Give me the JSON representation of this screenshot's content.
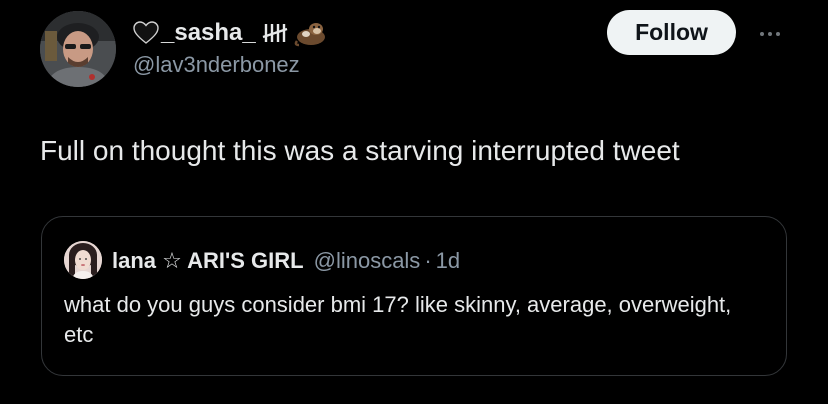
{
  "tweet": {
    "author": {
      "display_name": "_sasha_",
      "handle": "@lav3nderbonez",
      "name_emojis": [
        "black-heart-icon",
        "tally-marks-icon",
        "otter-icon"
      ]
    },
    "follow_label": "Follow",
    "text": "Full on thought this was a starving interrupted tweet"
  },
  "quoted": {
    "display_name": "lana ☆ ARI'S GIRL",
    "handle": "@linoscals",
    "separator": "·",
    "time": "1d",
    "text": "what do you guys consider bmi 17? like skinny, average, overweight, etc"
  },
  "colors": {
    "background": "#000000",
    "primary_text": "#e7e9ea",
    "secondary_text": "#8b98a5",
    "follow_bg": "#eff3f4",
    "border": "#333639"
  }
}
